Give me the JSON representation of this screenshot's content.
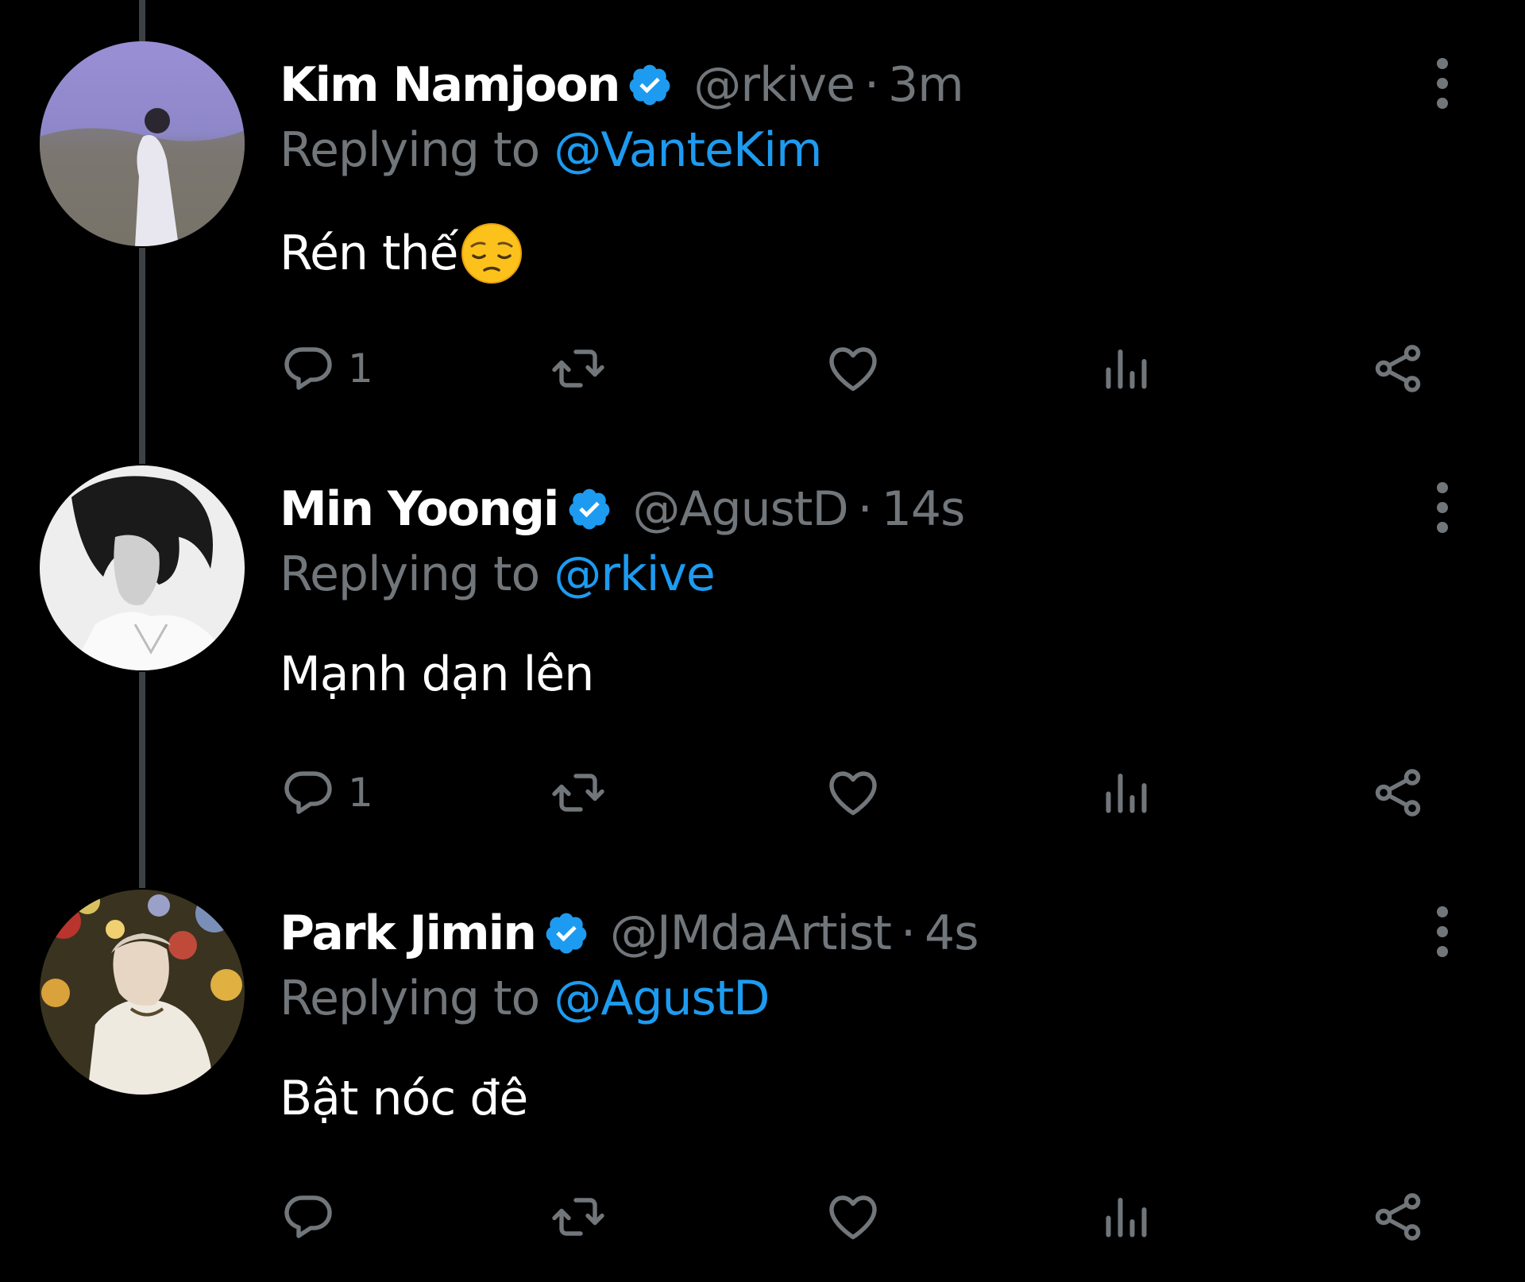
{
  "colors": {
    "background": "#000000",
    "text_primary": "#ffffff",
    "text_secondary": "#71767b",
    "accent": "#1d9bf0",
    "thread_line": "#3c4145"
  },
  "tweets": [
    {
      "name": "Kim Namjoon",
      "handle": "@rkive",
      "separator": "·",
      "time": "3m",
      "replying_prefix": "Replying to",
      "replying_to": "@VanteKim",
      "text": "Rén thế",
      "emoji": "pensive-face",
      "reply_count": "1",
      "avatar": "kim-namjoon-avatar"
    },
    {
      "name": "Min Yoongi",
      "handle": "@AgustD",
      "separator": "·",
      "time": "14s",
      "replying_prefix": "Replying to",
      "replying_to": "@rkive",
      "text": "Mạnh dạn lên",
      "reply_count": "1",
      "avatar": "min-yoongi-avatar"
    },
    {
      "name": "Park Jimin",
      "handle": "@JMdaArtist",
      "separator": "·",
      "time": "4s",
      "replying_prefix": "Replying to",
      "replying_to": "@AgustD",
      "text": "Bật nóc đê",
      "reply_count": "",
      "avatar": "park-jimin-avatar"
    }
  ],
  "icons": {
    "verified": "verified-badge-icon",
    "more": "more-options-icon",
    "reply": "reply-icon",
    "retweet": "retweet-icon",
    "like": "like-icon",
    "views": "views-icon",
    "share": "share-icon"
  }
}
